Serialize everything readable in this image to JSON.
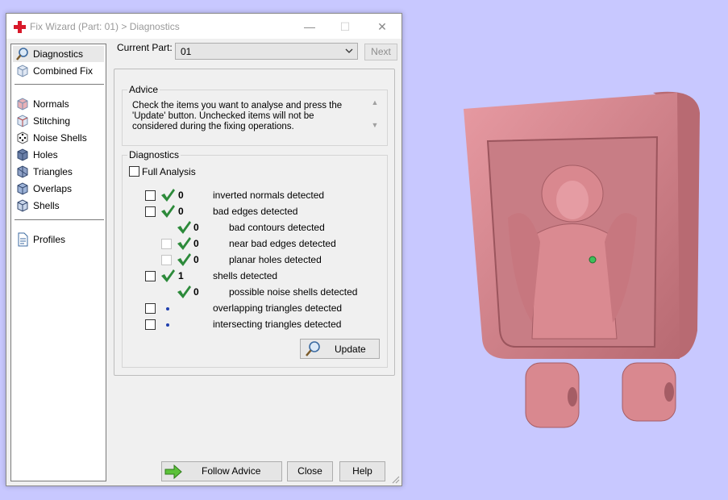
{
  "window": {
    "title": "Fix Wizard (Part: 01) > Diagnostics",
    "controls": {
      "minimize": "—",
      "maximize": "☐",
      "close": "✕"
    }
  },
  "sidebar": {
    "items": [
      {
        "label": "Diagnostics",
        "icon": "magnifier-icon",
        "active": true
      },
      {
        "label": "Combined Fix",
        "icon": "cube-icon"
      },
      {
        "label": "Normals",
        "icon": "normals-cube-icon"
      },
      {
        "label": "Stitching",
        "icon": "stitching-cube-icon"
      },
      {
        "label": "Noise Shells",
        "icon": "dice-icon"
      },
      {
        "label": "Holes",
        "icon": "holes-cube-icon"
      },
      {
        "label": "Triangles",
        "icon": "triangles-cube-icon"
      },
      {
        "label": "Overlaps",
        "icon": "overlaps-cube-icon"
      },
      {
        "label": "Shells",
        "icon": "shells-cube-icon"
      },
      {
        "label": "Profiles",
        "icon": "document-icon"
      }
    ]
  },
  "part": {
    "label": "Current Part:",
    "value": "01",
    "next": "Next"
  },
  "advice": {
    "legend": "Advice",
    "text": "Check the items you want to analyse and press the 'Update' button. Unchecked items will not be considered during the fixing operations."
  },
  "diagnostics": {
    "legend": "Diagnostics",
    "full_analysis": "Full Analysis",
    "rows": [
      {
        "count": "0",
        "label": "inverted normals detected",
        "status": "ok"
      },
      {
        "count": "0",
        "label": "bad edges detected",
        "status": "ok"
      },
      {
        "count": "0",
        "label": "bad contours detected",
        "status": "ok"
      },
      {
        "count": "0",
        "label": "near bad edges detected",
        "status": "ok"
      },
      {
        "count": "0",
        "label": "planar holes detected",
        "status": "ok"
      },
      {
        "count": "1",
        "label": "shells detected",
        "status": "ok"
      },
      {
        "count": "0",
        "label": "possible noise shells detected",
        "status": "ok"
      },
      {
        "count": "",
        "label": "overlapping triangles detected",
        "status": "pending"
      },
      {
        "count": "",
        "label": "intersecting triangles detected",
        "status": "pending"
      }
    ],
    "update": "Update"
  },
  "footer": {
    "follow": "Follow Advice",
    "close": "Close",
    "help": "Help"
  },
  "colors": {
    "check": "#2c8a3a",
    "model": "#d9888f",
    "background": "#c8c8ff"
  }
}
